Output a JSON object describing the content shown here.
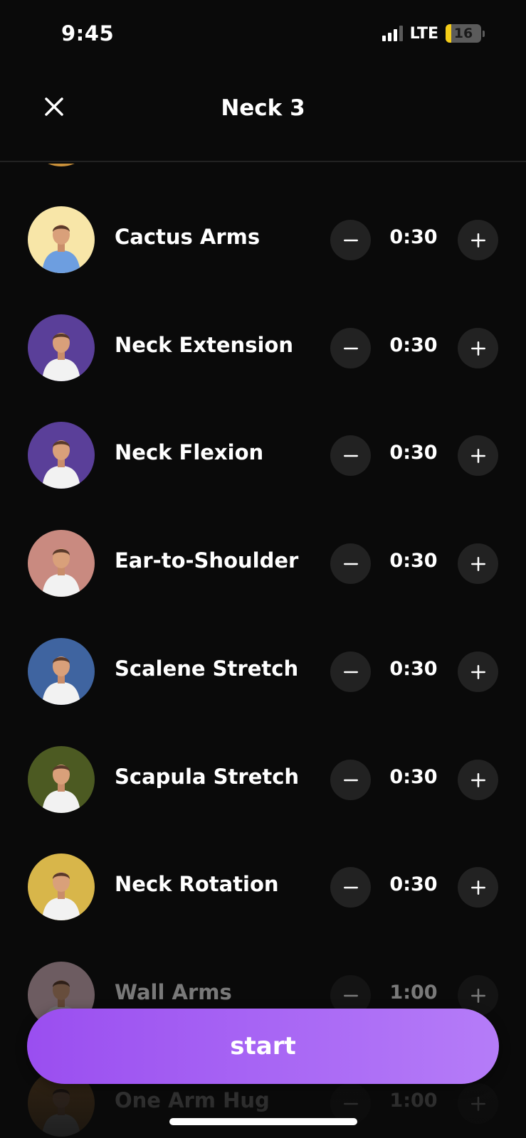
{
  "status_bar": {
    "time": "9:45",
    "network": "LTE",
    "battery": "16",
    "battery_level": 0.16,
    "signal_bars_active": 3,
    "signal_bars_total": 4
  },
  "header": {
    "title": "Neck 3",
    "close_icon": "close-icon"
  },
  "exercises": [
    {
      "name": "Cactus Arms",
      "duration": "0:30",
      "avatar_color": "#f8e6a8",
      "shirt_color": "#6d9ee0"
    },
    {
      "name": "Neck Extension",
      "duration": "0:30",
      "avatar_color": "#5a3f99",
      "shirt_color": "#f2f2f2"
    },
    {
      "name": "Neck Flexion",
      "duration": "0:30",
      "avatar_color": "#5a3f99",
      "shirt_color": "#f2f2f2"
    },
    {
      "name": "Ear-to-Shoulder",
      "duration": "0:30",
      "avatar_color": "#c98a80",
      "shirt_color": "#f2f2f2"
    },
    {
      "name": "Scalene Stretch",
      "duration": "0:30",
      "avatar_color": "#3f64a0",
      "shirt_color": "#f2f2f2"
    },
    {
      "name": "Scapula Stretch",
      "duration": "0:30",
      "avatar_color": "#4c5a22",
      "shirt_color": "#f2f2f2"
    },
    {
      "name": "Neck Rotation",
      "duration": "0:30",
      "avatar_color": "#d8b64a",
      "shirt_color": "#f2f2f2"
    },
    {
      "name": "Wall Arms",
      "duration": "1:00",
      "avatar_color": "#e6c0cc",
      "shirt_color": "#e6e6e6"
    },
    {
      "name": "One Arm Hug",
      "duration": "1:00",
      "avatar_color": "#c98a40",
      "shirt_color": "#e6e6e6"
    }
  ],
  "controls": {
    "decrement_icon": "minus-icon",
    "increment_icon": "plus-icon"
  },
  "start_button": {
    "label": "start"
  },
  "colors": {
    "background": "#0a0a0a",
    "accent_start": "#9a4ef0",
    "accent_end": "#b57cf8",
    "control_bg": "#222222"
  }
}
